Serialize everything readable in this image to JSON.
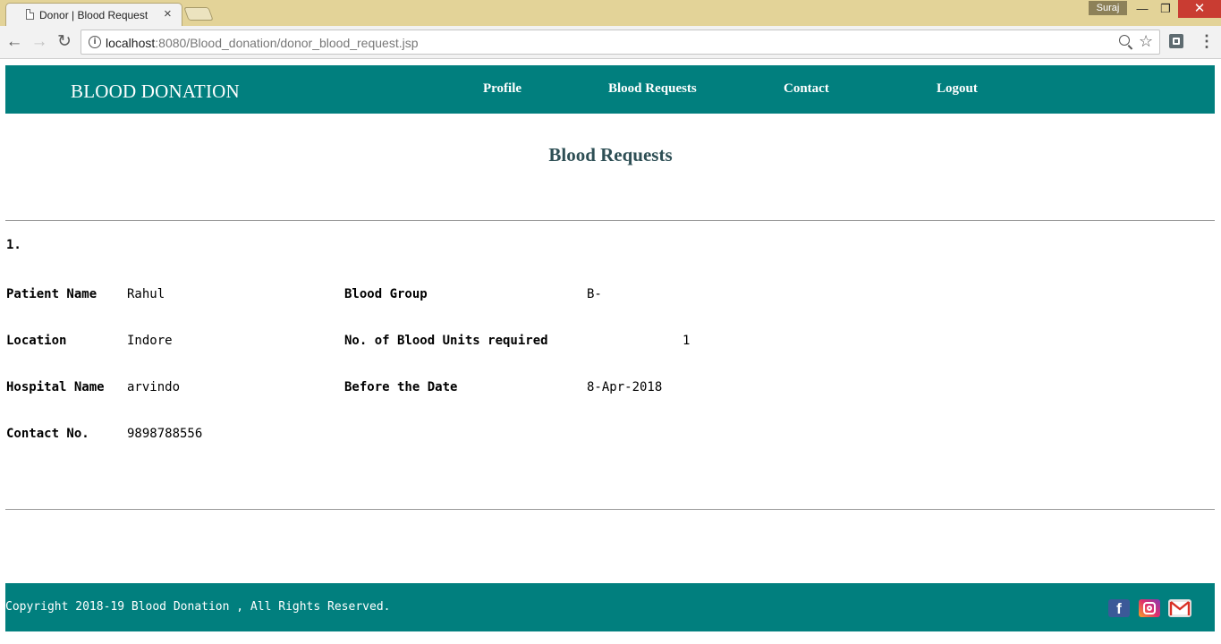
{
  "browser": {
    "tab_title": "Donor | Blood Request",
    "profile_name": "Suraj",
    "url_host": "localhost",
    "url_path": ":8080/Blood_donation/donor_blood_request.jsp"
  },
  "header": {
    "logo": "BLOOD DONATION",
    "nav": {
      "profile": "Profile",
      "blood_requests": "Blood Requests",
      "contact": "Contact",
      "logout": "Logout"
    }
  },
  "main": {
    "title": "Blood Requests",
    "requests": [
      {
        "index": "1.",
        "patient_name_label": "Patient Name",
        "patient_name": "Rahul",
        "blood_group_label": "Blood Group",
        "blood_group": "B-",
        "location_label": "Location",
        "location": "Indore",
        "units_label": "No. of Blood Units required",
        "units": "1",
        "hospital_label": "Hospital Name",
        "hospital": "arvindo",
        "date_label": "Before the Date",
        "date": "8-Apr-2018",
        "contact_label": "Contact No.",
        "contact": "9898788556"
      }
    ]
  },
  "footer": {
    "copyright": "Copyright 2018-19 Blood Donation , All Rights Reserved.",
    "facebook_glyph": "f"
  },
  "colors": {
    "brand_teal": "#017f7e",
    "title_color": "#2e4f55",
    "tabstrip": "#e3d398"
  }
}
